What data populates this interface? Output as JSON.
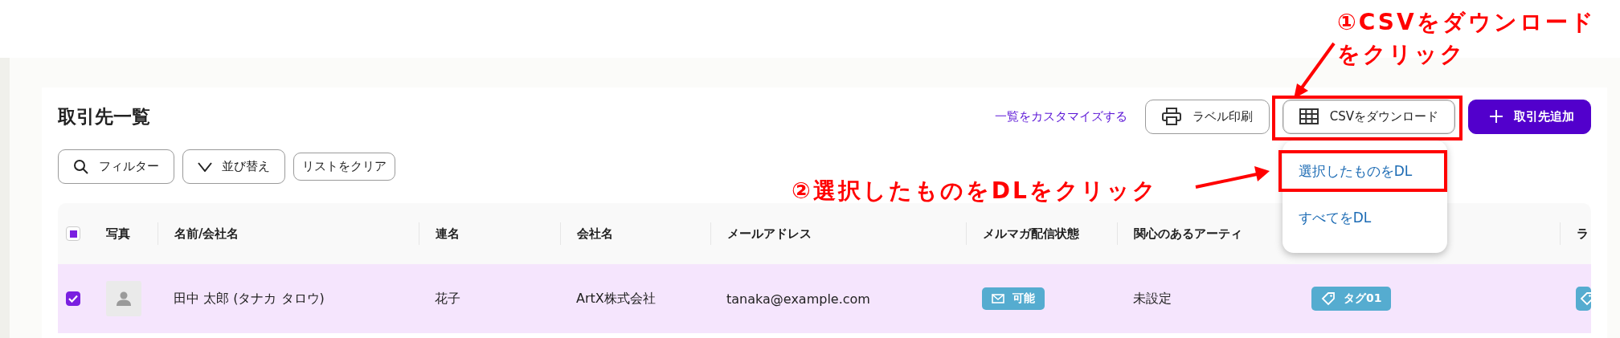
{
  "page": {
    "title": "取引先一覧",
    "customize_link": "一覧をカスタマイズする"
  },
  "header_buttons": [
    {
      "kind": "print",
      "label": "ラベル印刷",
      "expanded": false,
      "annotated": false
    },
    {
      "kind": "csv",
      "label": "CSVをダウンロード",
      "expanded": true,
      "annotated": true
    },
    {
      "kind": "add",
      "label": "取引先追加",
      "expanded": false,
      "annotated": false
    }
  ],
  "csv_menu": {
    "items": [
      {
        "label": "選択したものをDL",
        "annotated": true
      },
      {
        "label": "すべてをDL",
        "annotated": false
      }
    ]
  },
  "toolbar": [
    {
      "kind": "filter",
      "label": "フィルター"
    },
    {
      "kind": "sort",
      "label": "並び替え"
    },
    {
      "kind": "clear",
      "label": "リストをクリア"
    }
  ],
  "table": {
    "header_checkbox": {
      "indeterminate": true
    },
    "columns": [
      "写真",
      "名前/会社名",
      "連名",
      "会社名",
      "メールアドレス",
      "メルマガ配信状態",
      "関心のあるアーティ",
      "",
      "ラ"
    ],
    "rows": [
      {
        "selected": true,
        "cells": [
          {
            "kind": "avatar"
          },
          {
            "kind": "text",
            "text": "田中 太郎 (タナカ タロウ)"
          },
          {
            "kind": "text",
            "text": "花子"
          },
          {
            "kind": "text",
            "text": "ArtX株式会社"
          },
          {
            "kind": "text",
            "text": "tanaka@example.com"
          },
          {
            "kind": "mail_badge",
            "text": "可能"
          },
          {
            "kind": "text",
            "text": "未設定"
          },
          {
            "kind": "tag",
            "text": "タグ01"
          },
          {
            "kind": "tag"
          }
        ]
      }
    ]
  },
  "annotations": [
    {
      "kind": "callout",
      "lines": [
        "①CSVをダウンロード",
        "をクリック"
      ]
    },
    {
      "kind": "callout",
      "lines": [
        "②選択したものをDLをクリック"
      ]
    }
  ]
}
